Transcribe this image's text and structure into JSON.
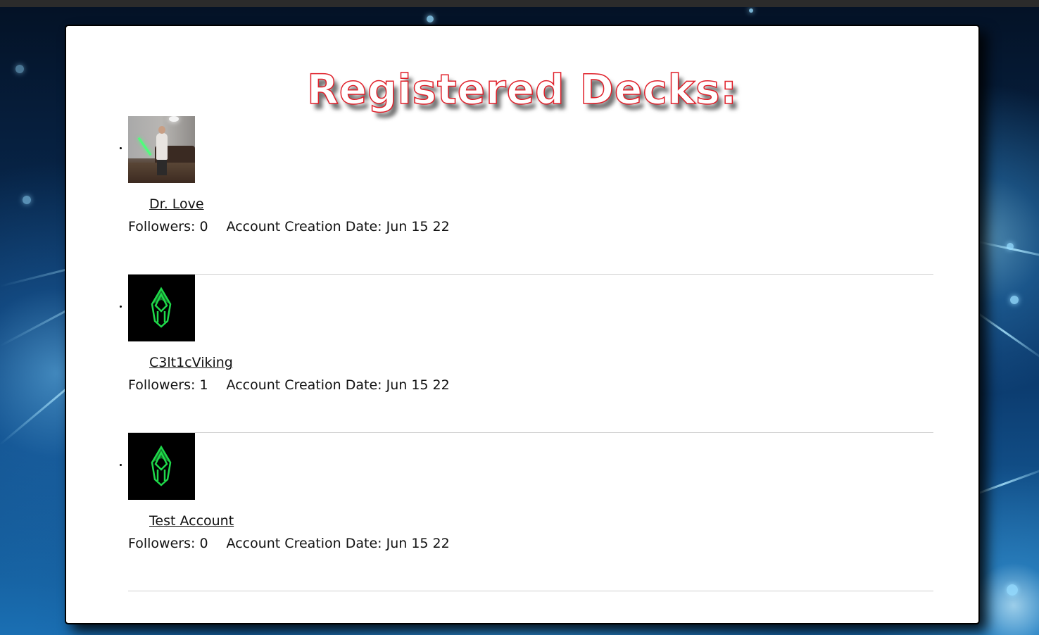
{
  "page": {
    "title": "Registered Decks:"
  },
  "decks": [
    {
      "name": "Dr. Love",
      "avatar": "user-photo",
      "followers_label": "Followers:",
      "followers": "0",
      "created_label": "Account Creation Date:",
      "created": "Jun 15 22"
    },
    {
      "name": "C3lt1cViking",
      "avatar": "green-emblem-logo",
      "followers_label": "Followers:",
      "followers": "1",
      "created_label": "Account Creation Date:",
      "created": "Jun 15 22"
    },
    {
      "name": "Test Account",
      "avatar": "green-emblem-logo",
      "followers_label": "Followers:",
      "followers": "0",
      "created_label": "Account Creation Date:",
      "created": "Jun 15 22"
    }
  ],
  "colors": {
    "title_stroke": "#e0202a",
    "emblem": "#1fd94a",
    "card_bg": "#ffffff",
    "background": "#0a3566"
  }
}
